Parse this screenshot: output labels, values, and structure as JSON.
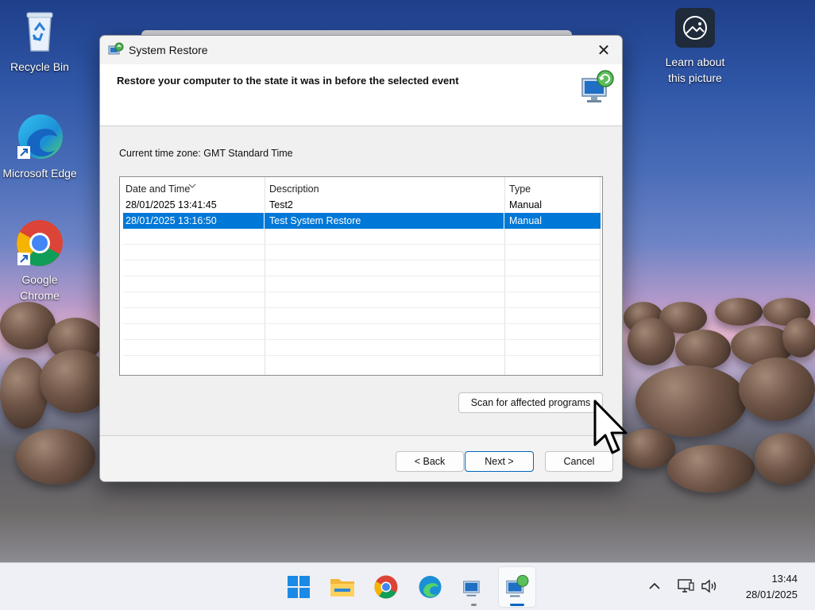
{
  "desktop": {
    "icons": [
      {
        "label": "Recycle Bin"
      },
      {
        "label": "Microsoft Edge"
      },
      {
        "label": "Google Chrome"
      }
    ],
    "learn_label": "Learn about this picture"
  },
  "window": {
    "title": "System Restore",
    "header_text": "Restore your computer to the state it was in before the selected event",
    "timezone": "Current time zone: GMT Standard Time",
    "columns": [
      "Date and Time",
      "Description",
      "Type"
    ],
    "rows": [
      {
        "date": "28/01/2025 13:41:45",
        "description": "Test2",
        "type": "Manual",
        "selected": false
      },
      {
        "date": "28/01/2025 13:16:50",
        "description": "Test System Restore",
        "type": "Manual",
        "selected": true
      }
    ],
    "scan_label": "Scan for affected programs",
    "back_label": "< Back",
    "next_label": "Next >",
    "cancel_label": "Cancel",
    "close_glyph": "✕"
  },
  "taskbar": {
    "apps": [
      "start-icon",
      "file-explorer-icon",
      "chrome-icon",
      "edge-icon",
      "system-restore-icon",
      "system-restore-active-icon"
    ],
    "time": "13:44",
    "date": "28/01/2025"
  },
  "colors": {
    "accent": "#0078d7",
    "selection": "#0078d7"
  }
}
